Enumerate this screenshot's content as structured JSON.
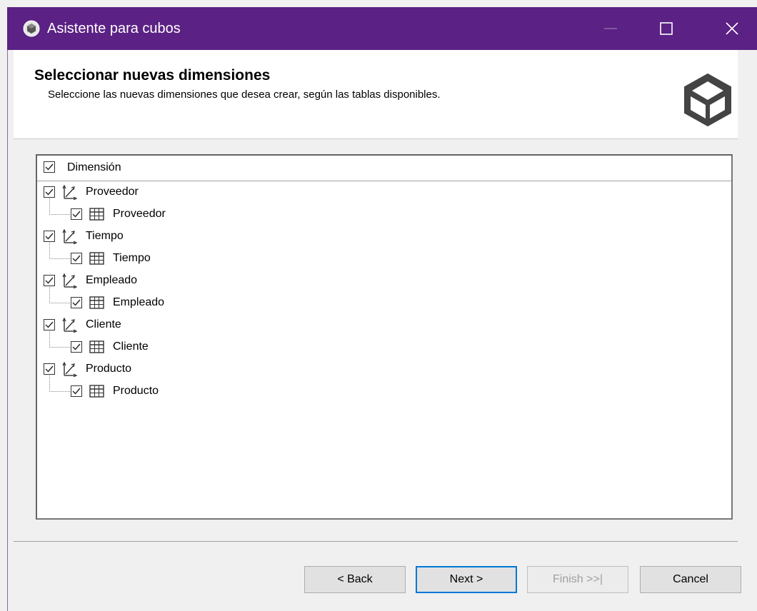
{
  "window": {
    "title": "Asistente para cubos",
    "accent": "#5b2184"
  },
  "header": {
    "title": "Seleccionar nuevas dimensiones",
    "subtitle": "Seleccione las nuevas dimensiones que desea crear, según las tablas disponibles.",
    "logo": "cube-icon"
  },
  "tree": {
    "column_header": "Dimensión",
    "column_checked": true,
    "dimensions": [
      {
        "label": "Proveedor",
        "checked": true,
        "icon": "dimension-icon",
        "table": {
          "label": "Proveedor",
          "checked": true,
          "icon": "table-icon"
        }
      },
      {
        "label": "Tiempo",
        "checked": true,
        "icon": "dimension-icon",
        "table": {
          "label": "Tiempo",
          "checked": true,
          "icon": "table-icon"
        }
      },
      {
        "label": "Empleado",
        "checked": true,
        "icon": "dimension-icon",
        "table": {
          "label": "Empleado",
          "checked": true,
          "icon": "table-icon"
        }
      },
      {
        "label": "Cliente",
        "checked": true,
        "icon": "dimension-icon",
        "table": {
          "label": "Cliente",
          "checked": true,
          "icon": "table-icon"
        }
      },
      {
        "label": "Producto",
        "checked": true,
        "icon": "dimension-icon",
        "table": {
          "label": "Producto",
          "checked": true,
          "icon": "table-icon"
        }
      }
    ]
  },
  "buttons": {
    "back": "< Back",
    "next": "Next >",
    "finish": "Finish >>|",
    "cancel": "Cancel"
  }
}
